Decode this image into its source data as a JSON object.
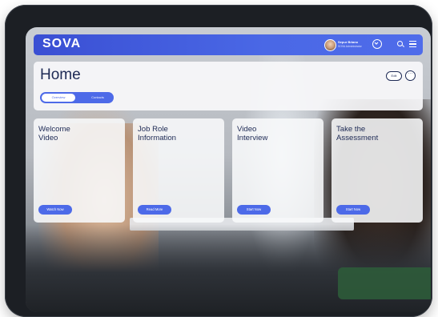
{
  "brand": {
    "logo_text": "SOVA"
  },
  "user": {
    "name": "Sepur Briano",
    "role": "SOVA Administrator"
  },
  "header": {
    "icons": [
      "chevron-down-icon",
      "search-icon",
      "menu-icon"
    ]
  },
  "page": {
    "title": "Home",
    "tabs": [
      {
        "label": "Overview"
      },
      {
        "label": "Contacts"
      }
    ],
    "edit_label": "Edit",
    "more_label": "···"
  },
  "cards": [
    {
      "title": "Welcome\nVideo",
      "button": "Watch Now"
    },
    {
      "title": "Job Role\nInformation",
      "button": "Read More"
    },
    {
      "title": "Video\nInterview",
      "button": "Start Now"
    },
    {
      "title": "Take the\nAssessment",
      "button": "Start Now"
    }
  ],
  "colors": {
    "brand_blue": "#4d6ae8",
    "text_navy": "#1e2a55"
  }
}
